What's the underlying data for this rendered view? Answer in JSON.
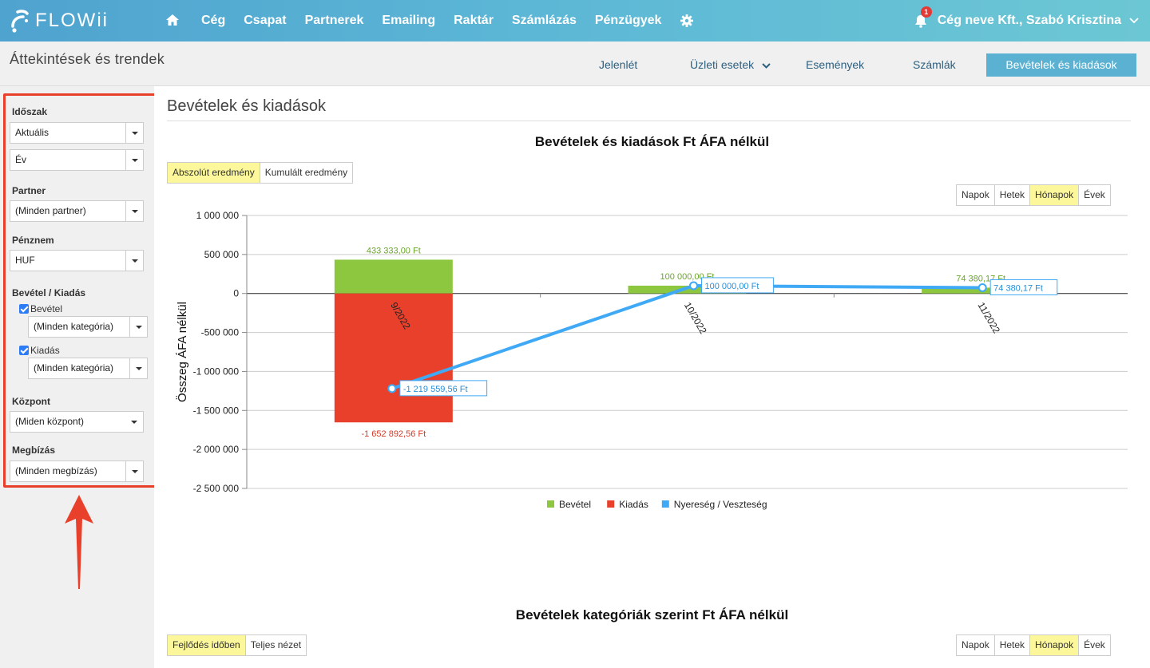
{
  "app": {
    "logo_text": "FLOWii",
    "nav": [
      "Cég",
      "Csapat",
      "Partnerek",
      "Emailing",
      "Raktár",
      "Számlázás",
      "Pénzügyek"
    ],
    "notification_count": "1",
    "user_label": "Cég neve Kft., Szabó Krisztina",
    "colors": {
      "topbar_start": "#4fa3cf",
      "topbar_end": "#6cc7d4",
      "active_tab": "#5bb1d1",
      "income": "#8dc63f",
      "expense": "#e8402b",
      "profit": "#3fa9f5",
      "annotation": "#e8402b"
    }
  },
  "subheader": {
    "title": "Áttekintések és trendek",
    "tabs": [
      "Jelenlét",
      "Üzleti esetek",
      "Események",
      "Számlák"
    ],
    "active_tab": "Bevételek és kiadások"
  },
  "sidebar": {
    "period_label": "Időszak",
    "period_value": "Aktuális",
    "period_unit_value": "Év",
    "partner_label": "Partner",
    "partner_value": "(Minden partner)",
    "currency_label": "Pénznem",
    "currency_value": "HUF",
    "income_expense_label": "Bevétel / Kiadás",
    "income_check_label": "Bevétel",
    "income_category_value": "(Minden kategória)",
    "expense_check_label": "Kiadás",
    "expense_category_value": "(Minden kategória)",
    "center_label": "Központ",
    "center_value": "(Miden központ)",
    "assignment_label": "Megbízás",
    "assignment_value": "(Minden megbízás)"
  },
  "main": {
    "title": "Bevételek és kiadások",
    "chart1_title": "Bevételek és kiadások Ft ÁFA nélkül",
    "mode_buttons": [
      "Abszolút eredmény",
      "Kumulált eredmény"
    ],
    "period_buttons": [
      "Napok",
      "Hetek",
      "Hónapok",
      "Évek"
    ],
    "chart2_title": "Bevételek kategóriák szerint Ft ÁFA nélkül",
    "mode2_buttons": [
      "Fejlődés időben",
      "Teljes nézet"
    ]
  },
  "chart_data": {
    "type": "bar",
    "title": "Bevételek és kiadások Ft ÁFA nélkül",
    "xlabel": "",
    "ylabel": "Összeg ÁFA nélkül",
    "ylim": [
      -2500000,
      1000000
    ],
    "yticks": [
      "1 000 000",
      "500 000",
      "0",
      "-500 000",
      "-1 000 000",
      "-1 500 000",
      "-2 000 000",
      "-2 500 000"
    ],
    "categories": [
      "9/2022",
      "10/2022",
      "11/2022"
    ],
    "series": [
      {
        "name": "Bevétel",
        "values": [
          433333.0,
          100000.0,
          74380.17
        ],
        "labels": [
          "433 333,00 Ft",
          "100 000,00 Ft",
          "74 380,17 Ft"
        ]
      },
      {
        "name": "Kiadás",
        "values": [
          -1652892.56,
          0,
          0
        ],
        "labels": [
          "-1 652 892,56 Ft",
          "",
          ""
        ]
      },
      {
        "name": "Nyereség / Veszteség",
        "values": [
          -1219559.56,
          100000.0,
          74380.17
        ],
        "labels": [
          "-1 219 559,56 Ft",
          "100 000,00 Ft",
          "74 380,17 Ft"
        ]
      }
    ],
    "legend": "bottom",
    "grid": true
  }
}
